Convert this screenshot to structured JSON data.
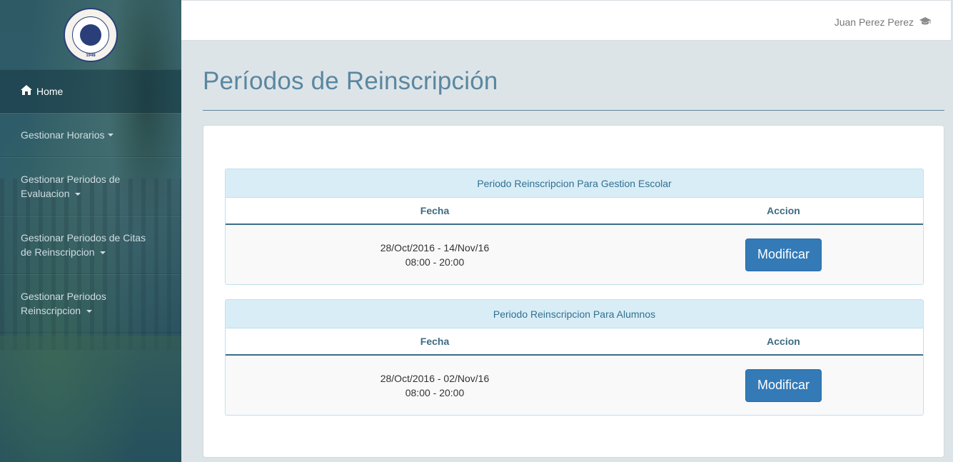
{
  "header": {
    "user_name": "Juan Perez Perez"
  },
  "logo": {
    "year": "1948"
  },
  "sidebar": {
    "items": [
      {
        "label": "Home"
      },
      {
        "label": "Gestionar Horarios"
      },
      {
        "label": "Gestionar Periodos de",
        "label2": "Evaluacion"
      },
      {
        "label": "Gestionar Periodos de Citas",
        "label2": "de Reinscripcion"
      },
      {
        "label": "Gestionar Periodos",
        "label2": "Reinscripcion"
      }
    ]
  },
  "main": {
    "title": "Períodos de Reinscripción",
    "panels": [
      {
        "heading": "Periodo Reinscripcion Para Gestion Escolar",
        "col_fecha": "Fecha",
        "col_accion": "Accion",
        "date_range": "28/Oct/2016 - 14/Nov/16",
        "time_range": "08:00 - 20:00",
        "button_label": "Modificar"
      },
      {
        "heading": "Periodo Reinscripcion Para Alumnos",
        "col_fecha": "Fecha",
        "col_accion": "Accion",
        "date_range": "28/Oct/2016 - 02/Nov/16",
        "time_range": "08:00 - 20:00",
        "button_label": "Modificar"
      }
    ]
  },
  "icons": {
    "home": "home-icon",
    "user": "graduation-cap-icon",
    "caret": "caret-down-icon"
  }
}
